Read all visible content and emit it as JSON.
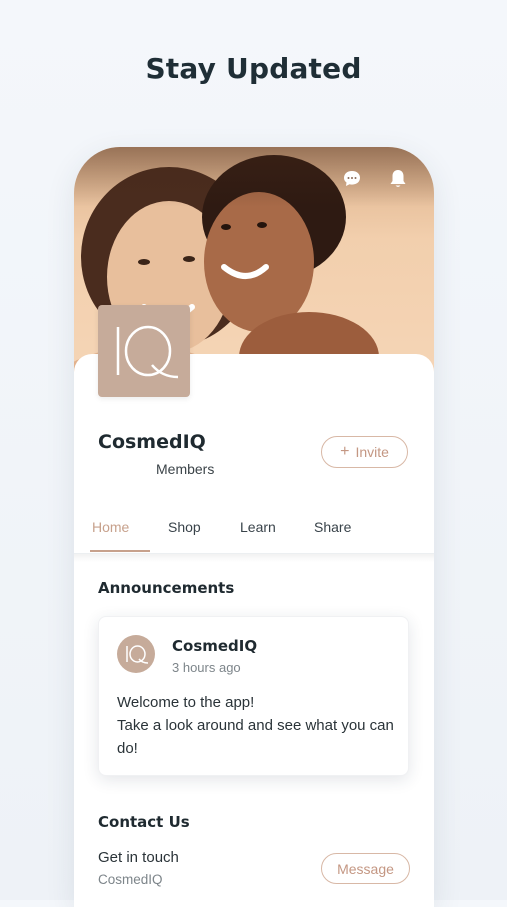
{
  "headline": "Stay Updated",
  "header": {
    "icons": [
      "chat-icon",
      "bell-icon"
    ]
  },
  "group": {
    "logo_text": "IQ",
    "name": "CosmedIQ",
    "members_label": "Members",
    "invite_label": "Invite"
  },
  "tabs": [
    {
      "label": "Home",
      "active": true
    },
    {
      "label": "Shop",
      "active": false
    },
    {
      "label": "Learn",
      "active": false
    },
    {
      "label": "Share",
      "active": false
    }
  ],
  "announcements": {
    "title": "Announcements",
    "post": {
      "author": "CosmedIQ",
      "avatar_text": "IQ",
      "time": "3 hours ago",
      "line1": "Welcome to the app!",
      "line2": "Take a look around and see what you can do!"
    }
  },
  "contact": {
    "title": "Contact Us",
    "subtitle": "Get in touch",
    "name": "CosmedIQ",
    "message_label": "Message"
  },
  "colors": {
    "accent": "#c7a18c",
    "logo_bg": "#c6ab9a",
    "text": "#1f2a30"
  }
}
